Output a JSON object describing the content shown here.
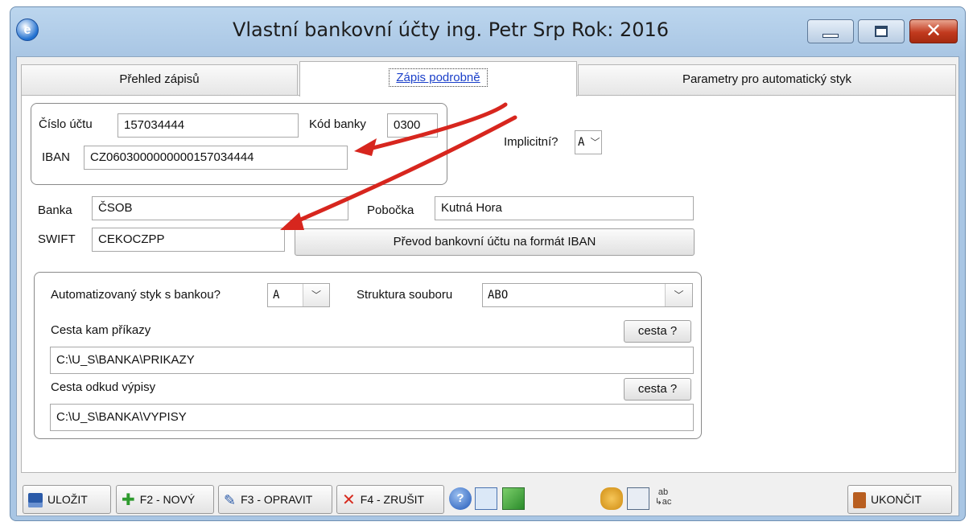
{
  "window": {
    "title": "Vlastní bankovní účty  ing. Petr Srp  Rok: 2016",
    "app_icon_letter": "e"
  },
  "tabs": [
    {
      "label": "Přehled zápisů"
    },
    {
      "label": "Zápis podrobně"
    },
    {
      "label": "Parametry pro automatický styk"
    }
  ],
  "account": {
    "cislo_label": "Číslo účtu",
    "cislo_value": "157034444",
    "kod_label": "Kód banky",
    "kod_value": "0300",
    "iban_label": "IBAN",
    "iban_value": "CZ0603000000000157034444",
    "implicitni_label": "Implicitní?",
    "implicitni_value": "A"
  },
  "bank": {
    "banka_label": "Banka",
    "banka_value": "ČSOB",
    "pobocka_label": "Pobočka",
    "pobocka_value": "Kutná Hora",
    "swift_label": "SWIFT",
    "swift_value": "CEKOCZPP",
    "convert_button": "Převod bankovní účtu na formát IBAN"
  },
  "auto": {
    "styk_label": "Automatizovaný styk s bankou?",
    "styk_value": "A",
    "struktura_label": "Struktura souboru",
    "struktura_value": "ABO",
    "prikazy_label": "Cesta kam příkazy",
    "prikazy_value": "C:\\U_S\\BANKA\\PRIKAZY",
    "vypisy_label": "Cesta odkud výpisy",
    "vypisy_value": "C:\\U_S\\BANKA\\VYPISY",
    "cesta_button": "cesta ?"
  },
  "toolbar": {
    "ulozit": "ULOŽIT",
    "novy": "F2 - NOVÝ",
    "opravit": "F3 - OPRAVIT",
    "zrusit": "F4 - ZRUŠIT",
    "ukoncit": "UKONČIT"
  },
  "colors": {
    "accent": "#1a3fc9",
    "arrow": "#d7261e"
  }
}
